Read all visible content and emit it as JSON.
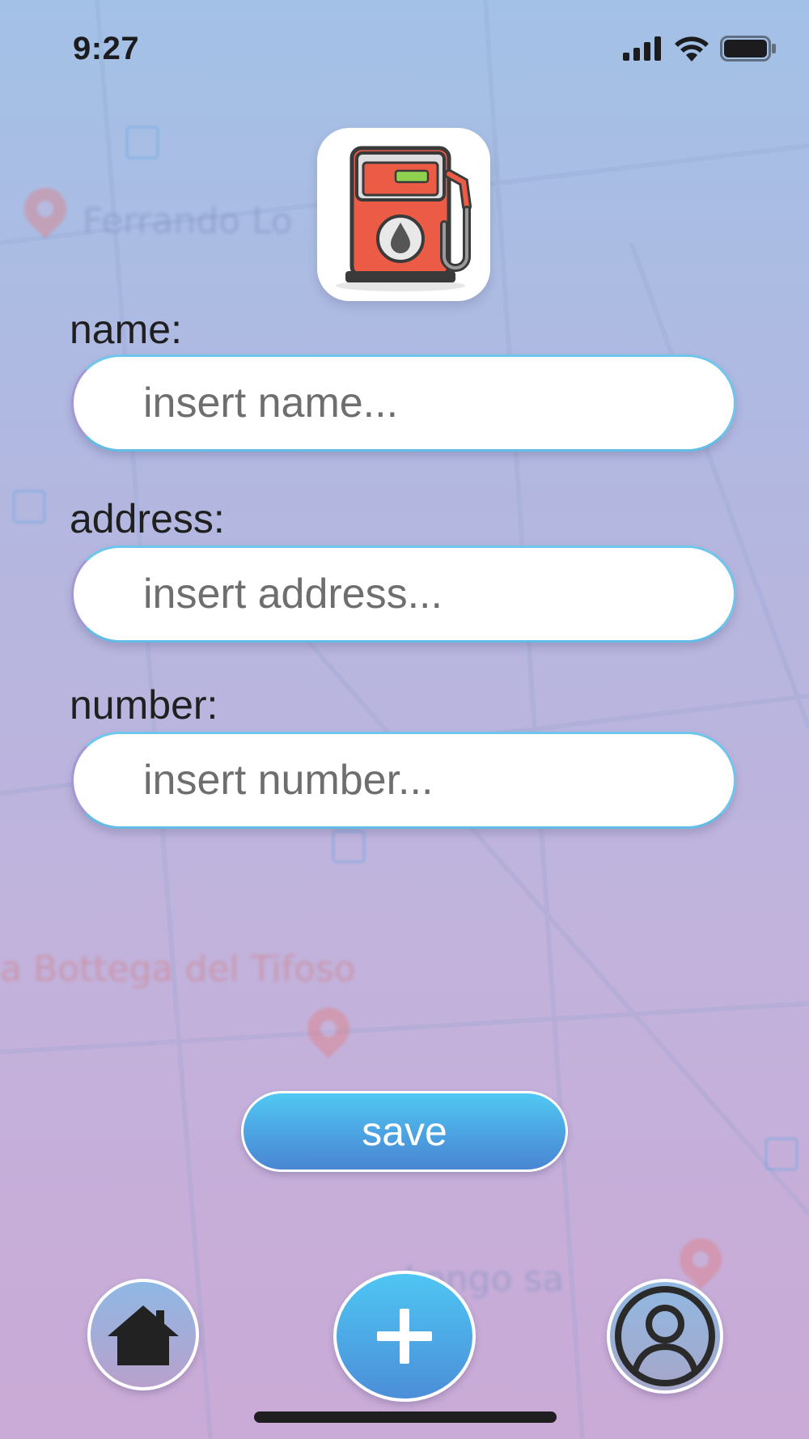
{
  "status_bar": {
    "time": "9:27",
    "icons": [
      "cellular-signal-icon",
      "wifi-icon",
      "battery-icon"
    ]
  },
  "logo": {
    "icon": "fuel-pump-icon"
  },
  "form": {
    "name": {
      "label": "name:",
      "placeholder": "insert name...",
      "value": ""
    },
    "address": {
      "label": "address:",
      "placeholder": "insert address...",
      "value": ""
    },
    "number": {
      "label": "number:",
      "placeholder": "insert number...",
      "value": ""
    }
  },
  "save_button": {
    "label": "save"
  },
  "bottom_nav": {
    "items": [
      {
        "icon": "home-icon"
      },
      {
        "icon": "plus-icon"
      },
      {
        "icon": "user-profile-icon"
      }
    ]
  },
  "background_map_labels": [
    "Ferrando Lo",
    "a Bottega del Tifoso",
    "Longo sa"
  ],
  "colors": {
    "accent": "#4fb5ec",
    "pump_red": "#ec5b45",
    "text": "#1f1f1f"
  }
}
